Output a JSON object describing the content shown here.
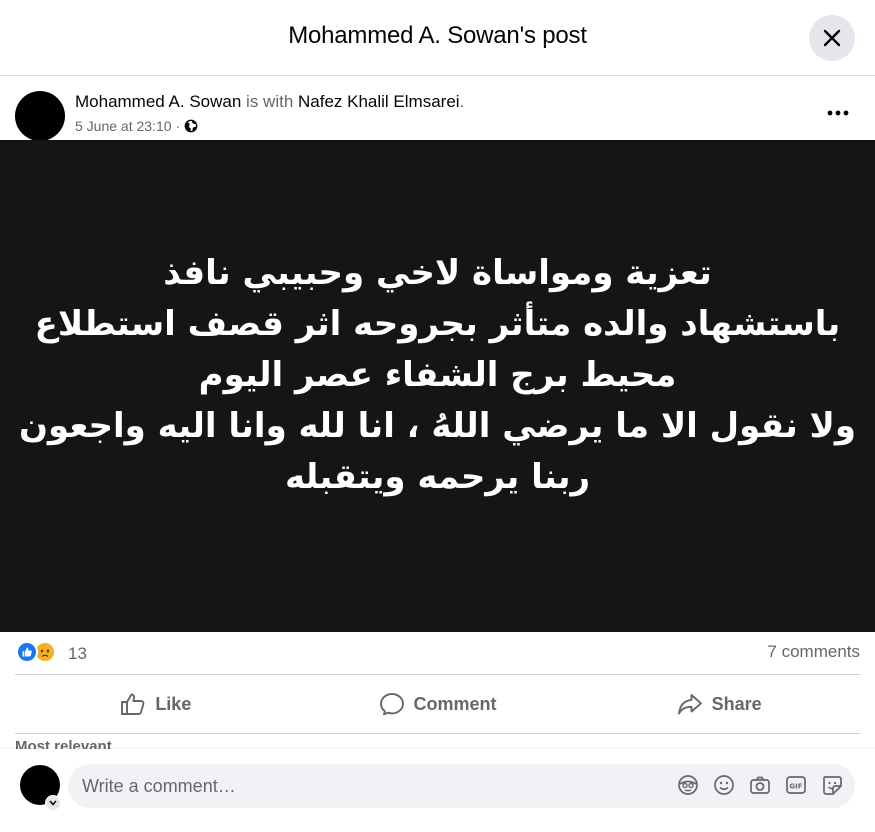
{
  "dialog": {
    "title": "Mohammed A. Sowan's post"
  },
  "post": {
    "author": "Mohammed A. Sowan",
    "with_text": " is with ",
    "tagged": "Nafez Khalil Elmsarei",
    "period": ".",
    "timestamp": "5 June at 23:10",
    "separator": "·",
    "privacy_icon": "globe-icon",
    "image_text_lines": [
      "تعزية ومواساة لاخي وحبيبي نافذ",
      "باستشهاد والده متأثر بجروحه اثر قصف استطلاع",
      "محيط برج الشفاء عصر اليوم",
      "ولا نقول الا ما يرضي اللهُ ، انا لله وانا اليه واجعون",
      "ربنا يرحمه ويتقبله"
    ]
  },
  "reactions": {
    "icons": [
      "like-reaction-icon",
      "sad-reaction-icon"
    ],
    "count": "13",
    "comments": "7 comments"
  },
  "actions": {
    "like": "Like",
    "comment": "Comment",
    "share": "Share"
  },
  "comments_section": {
    "sort_label": "Most relevant"
  },
  "composer": {
    "placeholder": "Write a comment…",
    "icons": [
      "avatar-sticker-icon",
      "emoji-icon",
      "camera-icon",
      "gif-icon",
      "sticker-icon"
    ]
  },
  "colors": {
    "accent": "#1877f2",
    "secondary_text": "#65676b",
    "image_bg": "#151515"
  }
}
